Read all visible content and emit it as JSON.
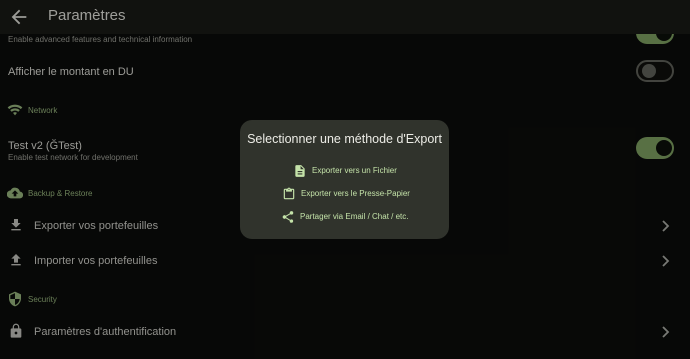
{
  "appbar": {
    "title": "Paramètres",
    "back_icon": "arrow-back-icon"
  },
  "advanced": {
    "subtitle": "Enable advanced features and technical information",
    "toggle_on": true
  },
  "du": {
    "label": "Afficher le montant en DU",
    "toggle_on": false
  },
  "network_section": {
    "label": "Network",
    "icon": "wifi-icon"
  },
  "testnet": {
    "label": "Test v2 (ĞTest)",
    "subtitle": "Enable test network for development",
    "toggle_on": true
  },
  "backup_section": {
    "label": "Backup & Restore",
    "icon": "cloud-upload-icon"
  },
  "export_row": {
    "label": "Exporter vos portefeuilles",
    "icon": "download-icon"
  },
  "import_row": {
    "label": "Importer vos portefeuilles",
    "icon": "upload-icon"
  },
  "security_section": {
    "label": "Security",
    "icon": "shield-icon"
  },
  "auth_row": {
    "label": "Paramètres d'authentification",
    "icon": "lock-icon"
  },
  "dialog": {
    "title": "Selectionner une méthode d'Export",
    "options": [
      {
        "label": "Exporter vers un Fichier",
        "icon": "file-icon"
      },
      {
        "label": "Exporter vers le Presse-Papier",
        "icon": "clipboard-icon"
      },
      {
        "label": "Partager via Email / Chat / etc.",
        "icon": "share-icon"
      }
    ]
  },
  "colors": {
    "accent": "#7a9b5f",
    "section": "#93b07a",
    "dialog_bg": "#30332c",
    "option_text": "#c4e3a9"
  }
}
